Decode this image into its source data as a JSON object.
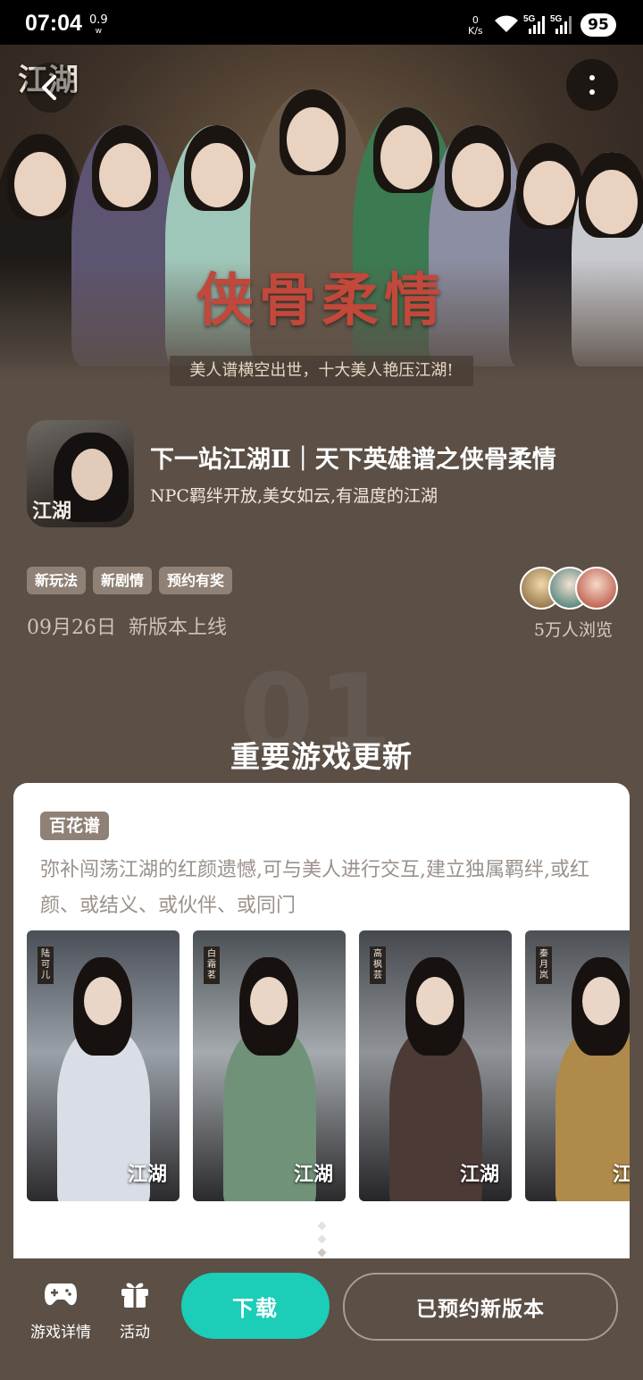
{
  "status_bar": {
    "time": "07:04",
    "speed_value": "0.9",
    "speed_unit": "w",
    "net_speed_value": "0",
    "net_speed_unit": "K/s",
    "network_1": "5G",
    "network_2": "5G",
    "battery": "95"
  },
  "hero": {
    "title": "侠骨柔情",
    "subtitle": "美人谱横空出世，十大美人艳压江湖!",
    "logo_text": "江湖"
  },
  "game": {
    "icon_logo": "江湖",
    "title": "下一站江湖Ⅱ｜天下英雄谱之侠骨柔情",
    "subtitle": "NPC羁绊开放,美女如云,有温度的江湖",
    "tags": [
      "新玩法",
      "新剧情",
      "预约有奖"
    ],
    "release_date": "09月26日",
    "release_note": "新版本上线",
    "views": "5万人浏览"
  },
  "section": {
    "number": "01",
    "title": "重要游戏更新"
  },
  "card": {
    "badge": "百花谱",
    "description": "弥补闯荡江湖的红颜遗憾,可与美人进行交互,建立独属羁绊,或红颜、或结义、或伙伴、或同门",
    "characters": [
      {
        "name": "陆可儿",
        "logo": "江湖"
      },
      {
        "name": "白霜茗",
        "logo": "江湖"
      },
      {
        "name": "高枫芸",
        "logo": "江湖"
      },
      {
        "name": "秦月岚",
        "logo": "江湖"
      }
    ]
  },
  "bottom_bar": {
    "game_details_label": "游戏详情",
    "activity_label": "活动",
    "download_label": "下载",
    "reserve_label": "已预约新版本"
  },
  "colors": {
    "background": "#5b4f46",
    "accent": "#1ccdb8",
    "tag_bg": "#8f8176",
    "hero_title": "#c1483b"
  }
}
